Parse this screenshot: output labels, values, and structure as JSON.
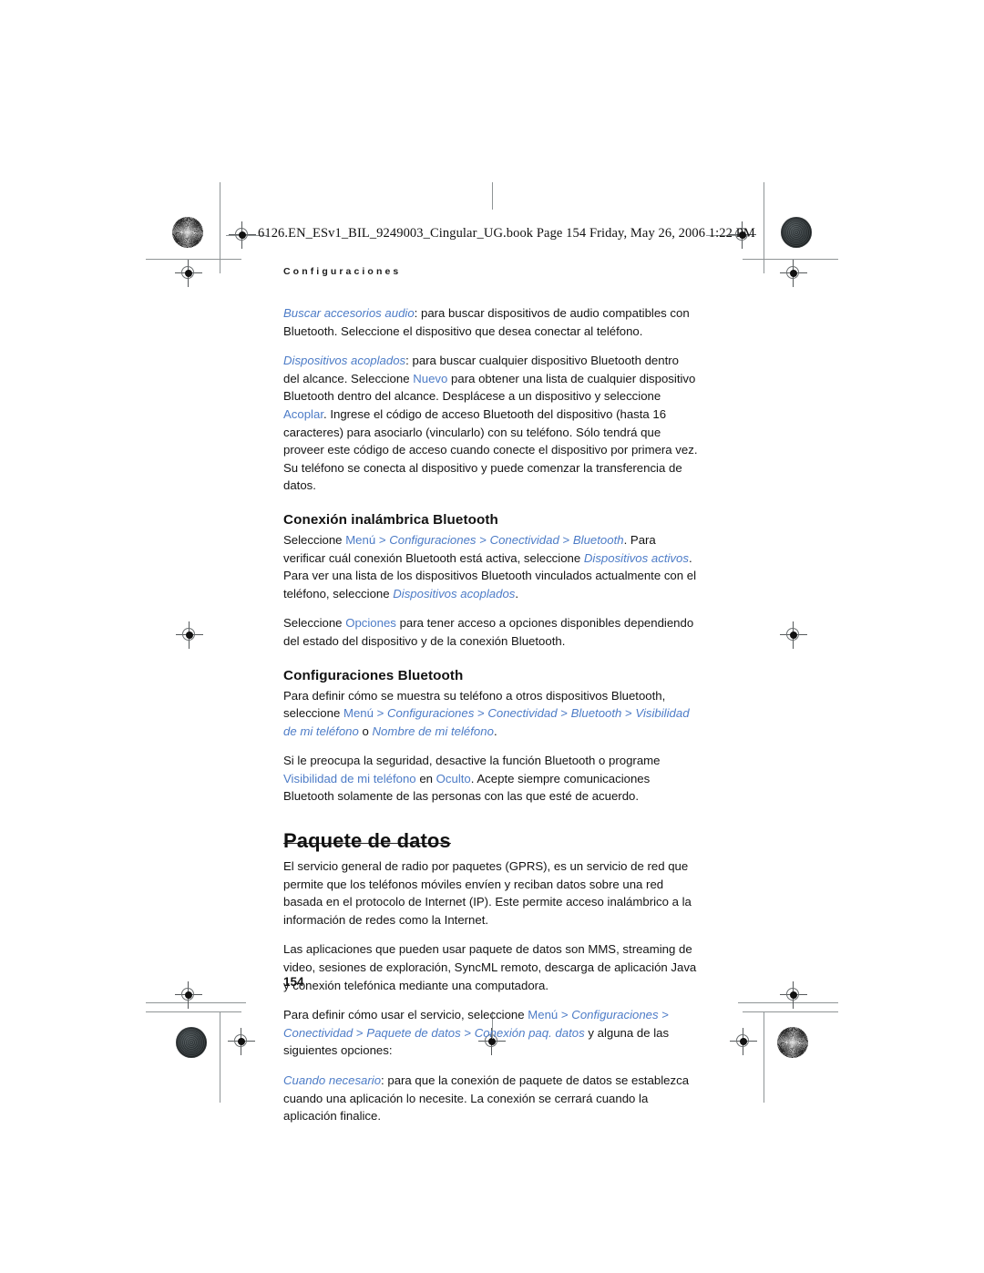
{
  "page": {
    "slug_line": "6126.EN_ESv1_BIL_9249003_Cingular_UG.book  Page 154  Friday, May 26, 2006  1:22 PM",
    "running_head": "Configuraciones",
    "folio": "154",
    "link_color": "#4d7cc7",
    "text_color": "#141414"
  },
  "body": {
    "p1": {
      "lead": "Buscar accesorios audio",
      "rest": ": para buscar dispositivos de audio compatibles con Bluetooth. Seleccione el dispositivo que desea conectar al teléfono."
    },
    "p2": {
      "lead": "Dispositivos acoplados",
      "t1": ": para buscar cualquier dispositivo Bluetooth dentro del alcance. Seleccione ",
      "l1": "Nuevo",
      "t2": " para obtener una lista de cualquier dispositivo Bluetooth dentro del alcance. Desplácese a un dispositivo y seleccione ",
      "l2": "Acoplar",
      "t3": ". Ingrese el código de acceso Bluetooth del dispositivo (hasta 16 caracteres) para asociarlo (vincularlo) con su teléfono. Sólo tendrá que proveer este código de acceso cuando conecte el dispositivo por primera vez. Su teléfono se conecta al dispositivo y puede comenzar la transferencia de datos."
    },
    "h_conexion": "Conexión inalámbrica Bluetooth",
    "p3": {
      "t1": "Seleccione ",
      "l1": "Menú",
      "s1": " > ",
      "l2": "Configuraciones",
      "s2": " > ",
      "l3": "Conectividad",
      "s3": " > ",
      "l4": "Bluetooth",
      "t2": ". Para verificar cuál conexión Bluetooth está activa, seleccione ",
      "l5": "Dispositivos activos",
      "t3": ". Para ver una lista de los dispositivos Bluetooth vinculados actualmente con el teléfono, seleccione ",
      "l6": "Dispositivos acoplados",
      "t4": "."
    },
    "p4": {
      "t1": "Seleccione ",
      "l1": "Opciones",
      "t2": " para tener acceso a opciones disponibles dependiendo del estado del dispositivo y de la conexión Bluetooth."
    },
    "h_config": "Configuraciones Bluetooth",
    "p5": {
      "t1": "Para definir cómo se muestra su teléfono a otros dispositivos Bluetooth, seleccione ",
      "l1": "Menú",
      "s1": " > ",
      "l2": "Configuraciones",
      "s2": " > ",
      "l3": "Conectividad",
      "s3": " > ",
      "l4": "Bluetooth",
      "s4": " > ",
      "l5": "Visibilidad de mi teléfono",
      "t2": " o ",
      "l6": "Nombre de mi teléfono",
      "t3": "."
    },
    "p6": {
      "t1": "Si le preocupa la seguridad, desactive la función Bluetooth o programe ",
      "l1": "Visibilidad de mi teléfono",
      "t2": " en ",
      "l2": "Oculto",
      "t3": ". Acepte siempre comunicaciones Bluetooth solamente de las personas con las que esté de acuerdo."
    },
    "h_paquete": "Paquete de datos",
    "p7": "El servicio general de radio por paquetes (GPRS), es un servicio de red que permite que los teléfonos móviles envíen y reciban datos sobre una red basada en el protocolo de Internet (IP). Este permite acceso inalámbrico a la información de redes como la Internet.",
    "p8": "Las aplicaciones que pueden usar paquete de datos son MMS, streaming de video, sesiones de exploración, SyncML remoto, descarga de aplicación Java y conexión telefónica mediante una computadora.",
    "p9": {
      "t1": "Para definir cómo usar el servicio, seleccione ",
      "l1": "Menú",
      "s1": " > ",
      "l2": "Configuraciones",
      "s2": " > ",
      "l3": "Conectividad",
      "s3": " > ",
      "l4": "Paquete de datos",
      "s4": " > ",
      "l5": "Conexión paq. datos",
      "t2": " y alguna de las siguientes opciones:"
    },
    "p10": {
      "lead": "Cuando necesario",
      "rest": ": para que la conexión de paquete de datos se establezca cuando una aplicación lo necesite. La conexión se cerrará cuando la aplicación finalice."
    }
  }
}
